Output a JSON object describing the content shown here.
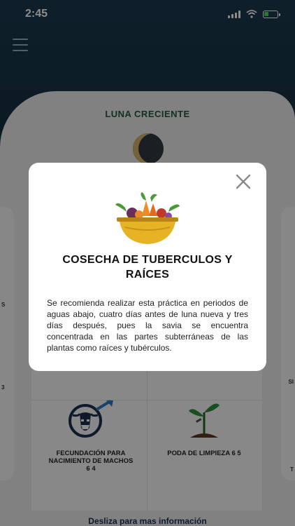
{
  "status_bar": {
    "time": "2:45"
  },
  "moon_phase": {
    "title": "LUNA CRECIENTE"
  },
  "side_fragments": {
    "left_a": "S",
    "left_b": "3",
    "right_a": "SI",
    "right_b": "T"
  },
  "activities": [
    {
      "label_line1": "FECUNDACIÓN PARA",
      "label_line2": "NACIMIENTO DE MACHOS",
      "label_line3": "6 4",
      "icon": "bull-male-icon"
    },
    {
      "label_line1": "PODA DE LIMPIEZA 6 5",
      "icon": "plant-pruning-icon"
    }
  ],
  "scroll_hint": "Desliza para mas información",
  "dialog": {
    "title_line1": "COSECHA DE TUBERCULOS Y",
    "title_line2": "RAÍCES",
    "body": "Se recomienda realizar esta práctica en periodos de aguas abajo, cuatro días antes de luna nueva y tres días después, pues la savia se encuentra concentrada en las partes subterráneas de las plantas como raíces y tubérculos.",
    "icon": "vegetable-basket-icon",
    "close_icon": "close-icon"
  },
  "colors": {
    "accent_green": "#1f5a3c",
    "basket_gold": "#e5b323",
    "navy": "#1a2c57"
  }
}
